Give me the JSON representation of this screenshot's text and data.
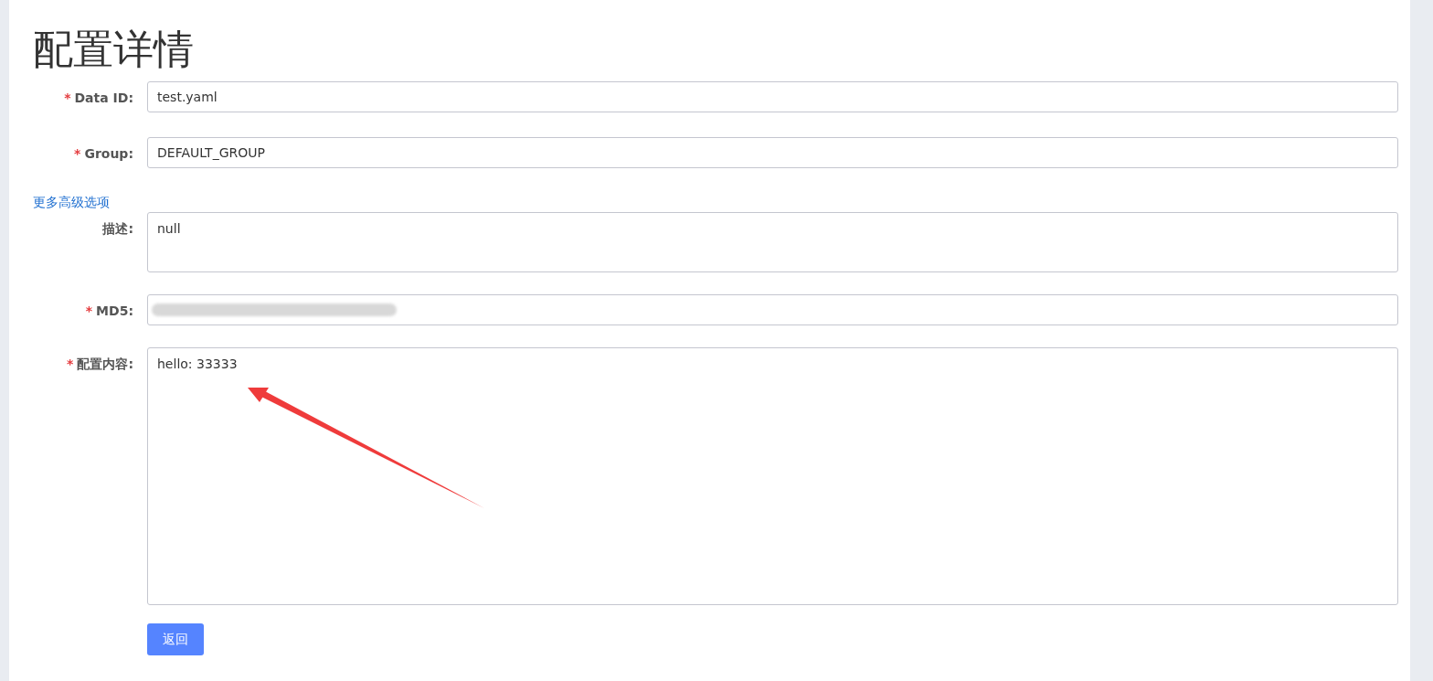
{
  "title": "配置详情",
  "fields_top": [
    {
      "kind": "input",
      "required": true,
      "required_mark": "*",
      "label": "Data ID:",
      "value": "test.yaml"
    },
    {
      "kind": "input",
      "required": true,
      "required_mark": "*",
      "label": "Group:",
      "value": "DEFAULT_GROUP"
    }
  ],
  "advanced_link": "更多高级选项",
  "fields": [
    {
      "kind": "textarea",
      "required": false,
      "label": "描述:",
      "value": "null"
    },
    {
      "kind": "redacted",
      "required": true,
      "required_mark": "*",
      "label": "MD5:"
    },
    {
      "kind": "tall-textarea",
      "required": true,
      "required_mark": "*",
      "label": "配置内容:",
      "value": "hello: 33333"
    }
  ],
  "back_button": "返回"
}
